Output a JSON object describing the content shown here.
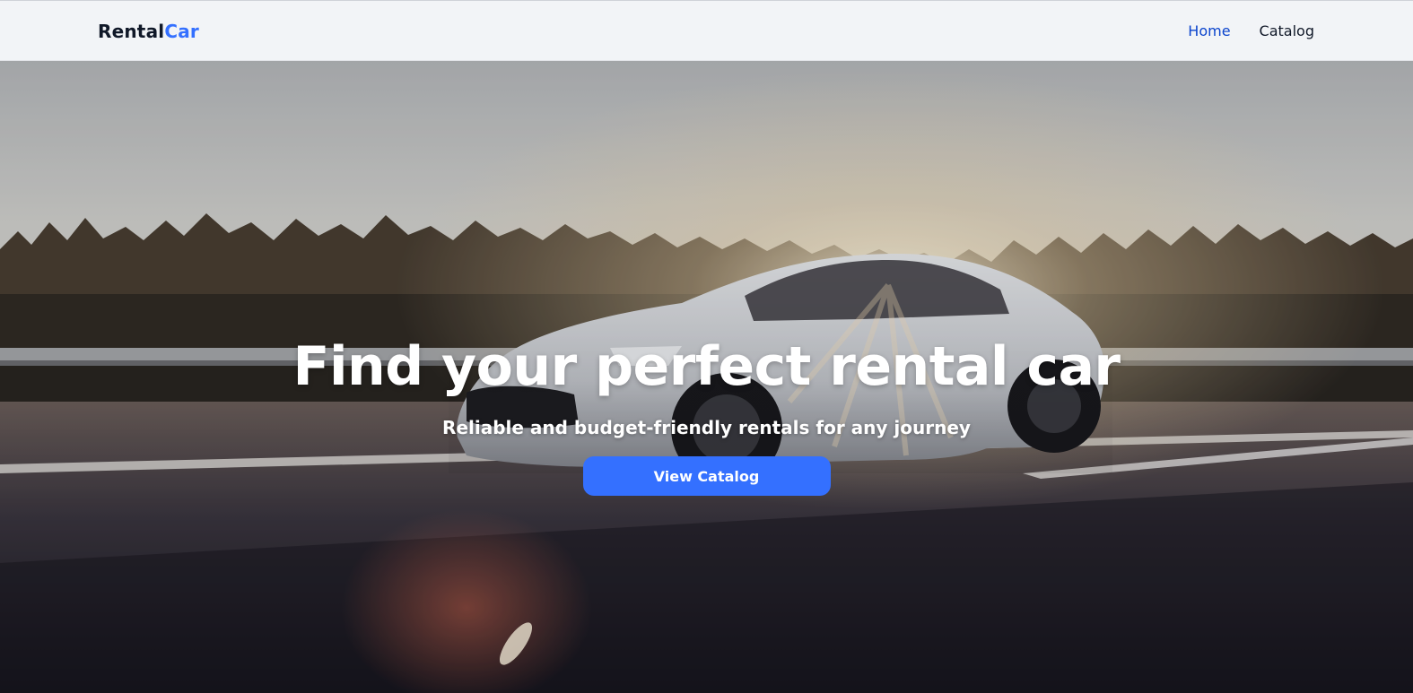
{
  "brand": {
    "logo_part1": "Rental",
    "logo_part2": "Car",
    "accent_color": "#3470ff"
  },
  "nav": {
    "items": [
      {
        "label": "Home",
        "active": true
      },
      {
        "label": "Catalog",
        "active": false
      }
    ],
    "active_color": "#0b44cd"
  },
  "hero": {
    "title": "Find your perfect rental car",
    "subtitle": "Reliable and budget-friendly rentals for any journey",
    "cta_label": "View Catalog",
    "background_image": "white sports car driving on highway at sunset"
  }
}
